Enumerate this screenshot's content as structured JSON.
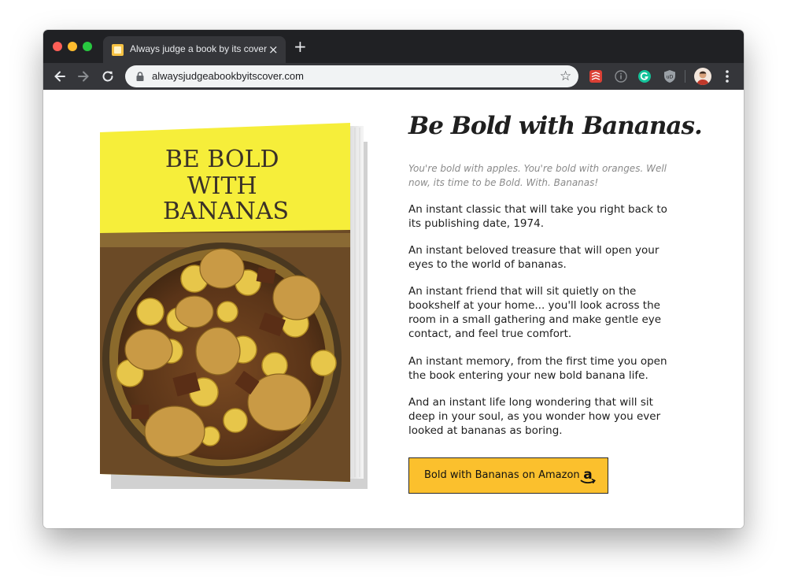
{
  "browser": {
    "tab_title": "Always judge a book by its cover",
    "tab_close": "×",
    "new_tab": "+",
    "url": "alwaysjudgeabookbyitscover.com",
    "star": "☆"
  },
  "book_cover": {
    "title_lines": [
      "BE BOLD",
      "WITH",
      "BANANAS"
    ],
    "colors": {
      "cover_yellow": "#f6ee3a",
      "photo_tone": "#6b4a26"
    }
  },
  "content": {
    "headline": "Be Bold with Bananas.",
    "lede": "You're bold with apples. You're bold with oranges. Well now, its time to be Bold. With. Bananas!",
    "paragraphs": [
      "An instant classic that will take you right back to its publishing date, 1974.",
      "An instant beloved treasure that will open your eyes to the world of bananas.",
      "An instant friend that will sit quietly on the bookshelf at your home... you'll look across the room in a small gathering and make gentle eye contact, and feel true comfort.",
      "An instant memory, from the first time you open the book entering your new bold banana life.",
      "And an instant life long wondering that will sit deep in your soul, as you wonder how you ever looked at bananas as boring."
    ],
    "cta_label": "Bold with Bananas on Amazon",
    "cta_icon": "amazon-icon"
  },
  "colors": {
    "cta_background": "#fbc02d",
    "browser_frame": "#202124",
    "toolbar": "#35363a"
  }
}
